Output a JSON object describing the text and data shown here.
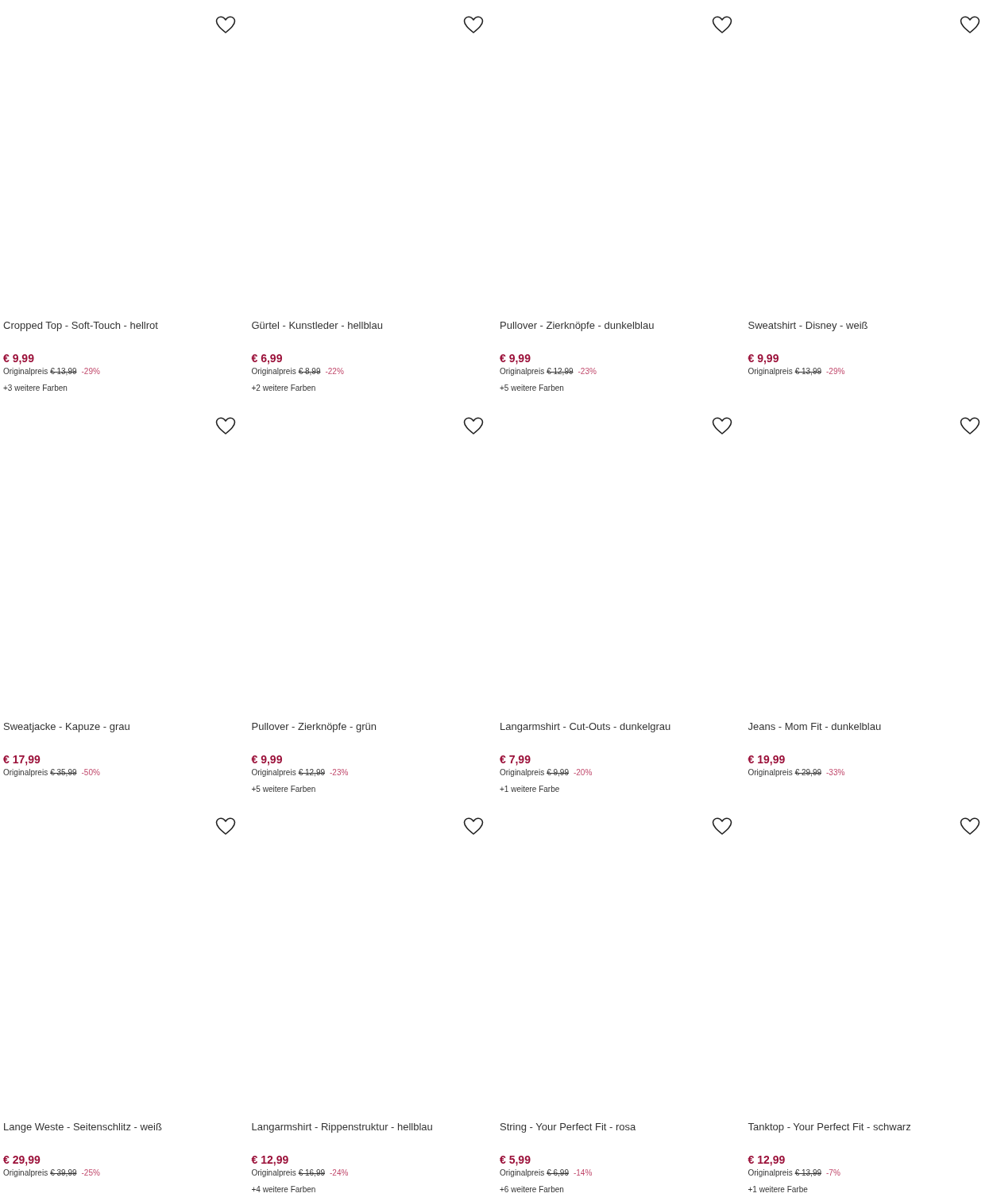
{
  "products": [
    {
      "title": "Cropped Top - Soft-Touch - hellrot",
      "price": "€ 9,99",
      "original_label": "Originalpreis",
      "original_price": "€ 13,99",
      "discount": "-29%",
      "more_colors": "+3 weitere Farben",
      "favorite": false
    },
    {
      "title": "Gürtel - Kunstleder - hellblau",
      "price": "€ 6,99",
      "original_label": "Originalpreis",
      "original_price": "€ 8,99",
      "discount": "-22%",
      "more_colors": "+2 weitere Farben",
      "favorite": false
    },
    {
      "title": "Pullover - Zierknöpfe - dunkelblau",
      "price": "€ 9,99",
      "original_label": "Originalpreis",
      "original_price": "€ 12,99",
      "discount": "-23%",
      "more_colors": "+5 weitere Farben",
      "favorite": false
    },
    {
      "title": "Sweatshirt - Disney - weiß",
      "price": "€ 9,99",
      "original_label": "Originalpreis",
      "original_price": "€ 13,99",
      "discount": "-29%",
      "favorite": false
    },
    {
      "title": "Sweatjacke - Kapuze - grau",
      "price": "€ 17,99",
      "original_label": "Originalpreis",
      "original_price": "€ 35,99",
      "discount": "-50%",
      "favorite": false
    },
    {
      "title": "Pullover - Zierknöpfe - grün",
      "price": "€ 9,99",
      "original_label": "Originalpreis",
      "original_price": "€ 12,99",
      "discount": "-23%",
      "more_colors": "+5 weitere Farben",
      "favorite": false
    },
    {
      "title": "Langarmshirt - Cut-Outs - dunkelgrau",
      "price": "€ 7,99",
      "original_label": "Originalpreis",
      "original_price": "€ 9,99",
      "discount": "-20%",
      "more_colors": "+1 weitere Farbe",
      "favorite": false
    },
    {
      "title": "Jeans - Mom Fit - dunkelblau",
      "price": "€ 19,99",
      "original_label": "Originalpreis",
      "original_price": "€ 29,99",
      "discount": "-33%",
      "favorite": false
    },
    {
      "title": "Lange Weste - Seitenschlitz - weiß",
      "price": "€ 29,99",
      "original_label": "Originalpreis",
      "original_price": "€ 39,99",
      "discount": "-25%",
      "favorite": false
    },
    {
      "title": "Langarmshirt - Rippenstruktur - hellblau",
      "price": "€ 12,99",
      "original_label": "Originalpreis",
      "original_price": "€ 16,99",
      "discount": "-24%",
      "more_colors": "+4 weitere Farben",
      "favorite": false
    },
    {
      "title": "String - Your Perfect Fit - rosa",
      "price": "€ 5,99",
      "original_label": "Originalpreis",
      "original_price": "€ 6,99",
      "discount": "-14%",
      "more_colors": "+6 weitere Farben",
      "favorite": false
    },
    {
      "title": "Tanktop - Your Perfect Fit - schwarz",
      "price": "€ 12,99",
      "original_label": "Originalpreis",
      "original_price": "€ 13,99",
      "discount": "-7%",
      "more_colors": "+1 weitere Farbe",
      "favorite": false
    }
  ]
}
